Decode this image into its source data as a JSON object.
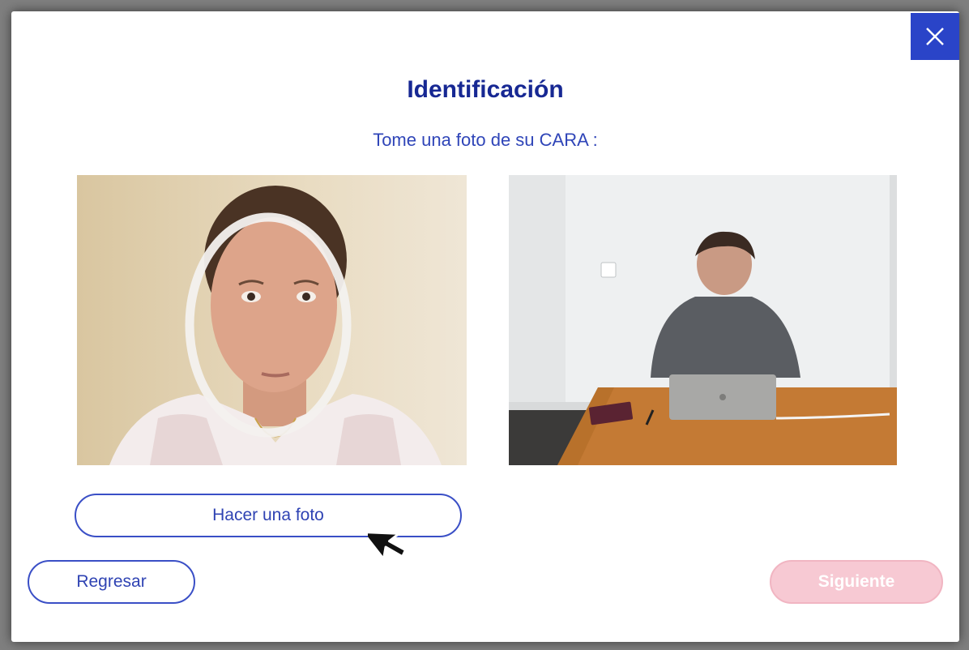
{
  "dialog": {
    "title": "Identificación",
    "subtitle": "Tome una foto de su CARA :"
  },
  "buttons": {
    "take_photo": "Hacer una foto",
    "back": "Regresar",
    "next": "Siguiente"
  },
  "icons": {
    "close": "close-icon",
    "cursor": "mouse-pointer-icon"
  },
  "colors": {
    "accent": "#2a44c8",
    "title": "#172893",
    "next_disabled": "#f7c9d3"
  }
}
